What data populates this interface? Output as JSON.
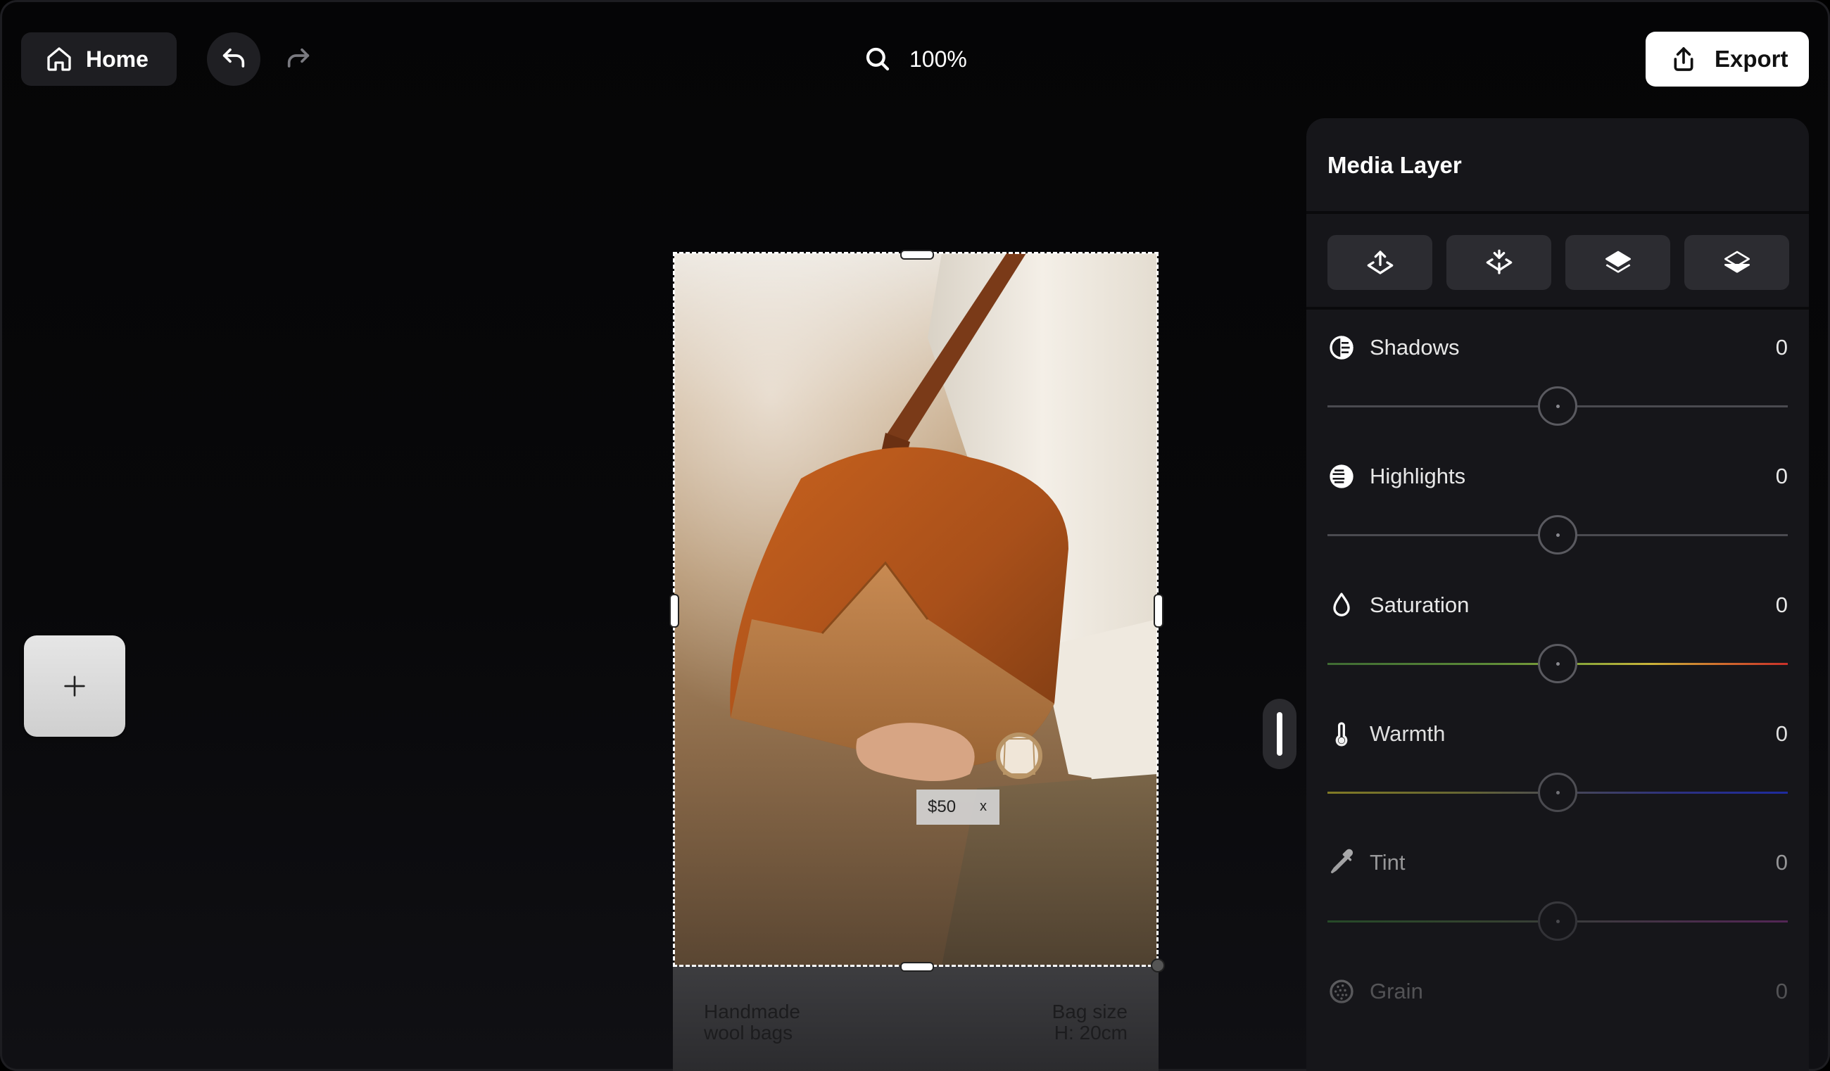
{
  "toolbar": {
    "home_label": "Home",
    "zoom_level": "100%",
    "export_label": "Export"
  },
  "canvas": {
    "price_tag": "$50",
    "price_tag_close": "x",
    "card_left_text_1": "Handmade",
    "card_left_text_2": "wool bags",
    "card_right_text_1": "Bag size",
    "card_right_text_2": "H: 20cm"
  },
  "panel": {
    "title": "Media Layer",
    "layer_buttons": [
      {
        "icon": "bring-forward-icon"
      },
      {
        "icon": "send-backward-icon"
      },
      {
        "icon": "bring-to-front-icon"
      },
      {
        "icon": "send-to-back-icon"
      }
    ],
    "adjustments": [
      {
        "label": "Shadows",
        "value": "0",
        "icon": "shadows-icon",
        "level": 0.5
      },
      {
        "label": "Highlights",
        "value": "0",
        "icon": "highlights-icon",
        "level": 0.5
      },
      {
        "label": "Saturation",
        "value": "0",
        "icon": "saturation-drop-icon",
        "level": 0.5
      },
      {
        "label": "Warmth",
        "value": "0",
        "icon": "thermometer-icon",
        "level": 0.5
      },
      {
        "label": "Tint",
        "value": "0",
        "icon": "eyedropper-icon",
        "level": 0.5
      },
      {
        "label": "Grain",
        "value": "0",
        "icon": "grain-icon",
        "level": 0.5
      }
    ]
  },
  "colors": {
    "saturation_track": [
      "#4a7a3a",
      "#7aa63a",
      "#c9b43a",
      "#c9382e"
    ],
    "warmth_track": [
      "#a59a2a",
      "#6a6a50",
      "#3a3aa0",
      "#1a2ac0"
    ],
    "tint_track": [
      "#3a8a3a",
      "#6a6a6a",
      "#9a3a9a"
    ]
  }
}
